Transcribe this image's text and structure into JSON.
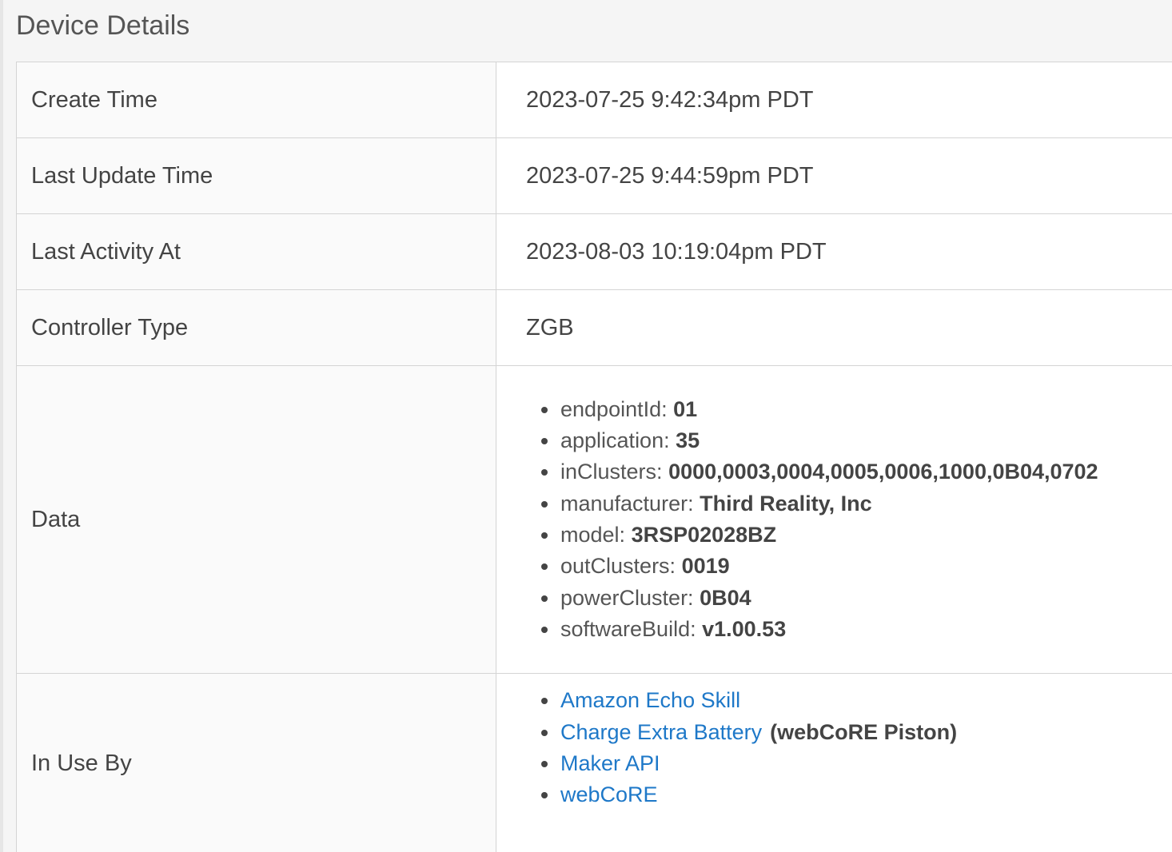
{
  "section_title": "Device Details",
  "rows": [
    {
      "label": "Create Time",
      "value": "2023-07-25 9:42:34pm PDT"
    },
    {
      "label": "Last Update Time",
      "value": "2023-07-25 9:44:59pm PDT"
    },
    {
      "label": "Last Activity At",
      "value": "2023-08-03 10:19:04pm PDT"
    },
    {
      "label": "Controller Type",
      "value": "ZGB"
    }
  ],
  "data_row": {
    "label": "Data",
    "items": [
      {
        "key": "endpointId:",
        "value": "01"
      },
      {
        "key": "application:",
        "value": "35"
      },
      {
        "key": "inClusters:",
        "value": "0000,0003,0004,0005,0006,1000,0B04,0702"
      },
      {
        "key": "manufacturer:",
        "value": "Third Reality, Inc"
      },
      {
        "key": "model:",
        "value": "3RSP02028BZ"
      },
      {
        "key": "outClusters:",
        "value": "0019"
      },
      {
        "key": "powerCluster:",
        "value": "0B04"
      },
      {
        "key": "softwareBuild:",
        "value": "v1.00.53"
      }
    ]
  },
  "in_use_row": {
    "label": "In Use By",
    "apps": [
      {
        "name": "Amazon Echo Skill",
        "note": ""
      },
      {
        "name": "Charge Extra Battery",
        "note": "(webCoRE Piston)"
      },
      {
        "name": "Maker API",
        "note": ""
      },
      {
        "name": "webCoRE",
        "note": ""
      }
    ]
  },
  "colors": {
    "link": "#1e78c8",
    "border": "#d4d4d4",
    "text": "#444444"
  }
}
